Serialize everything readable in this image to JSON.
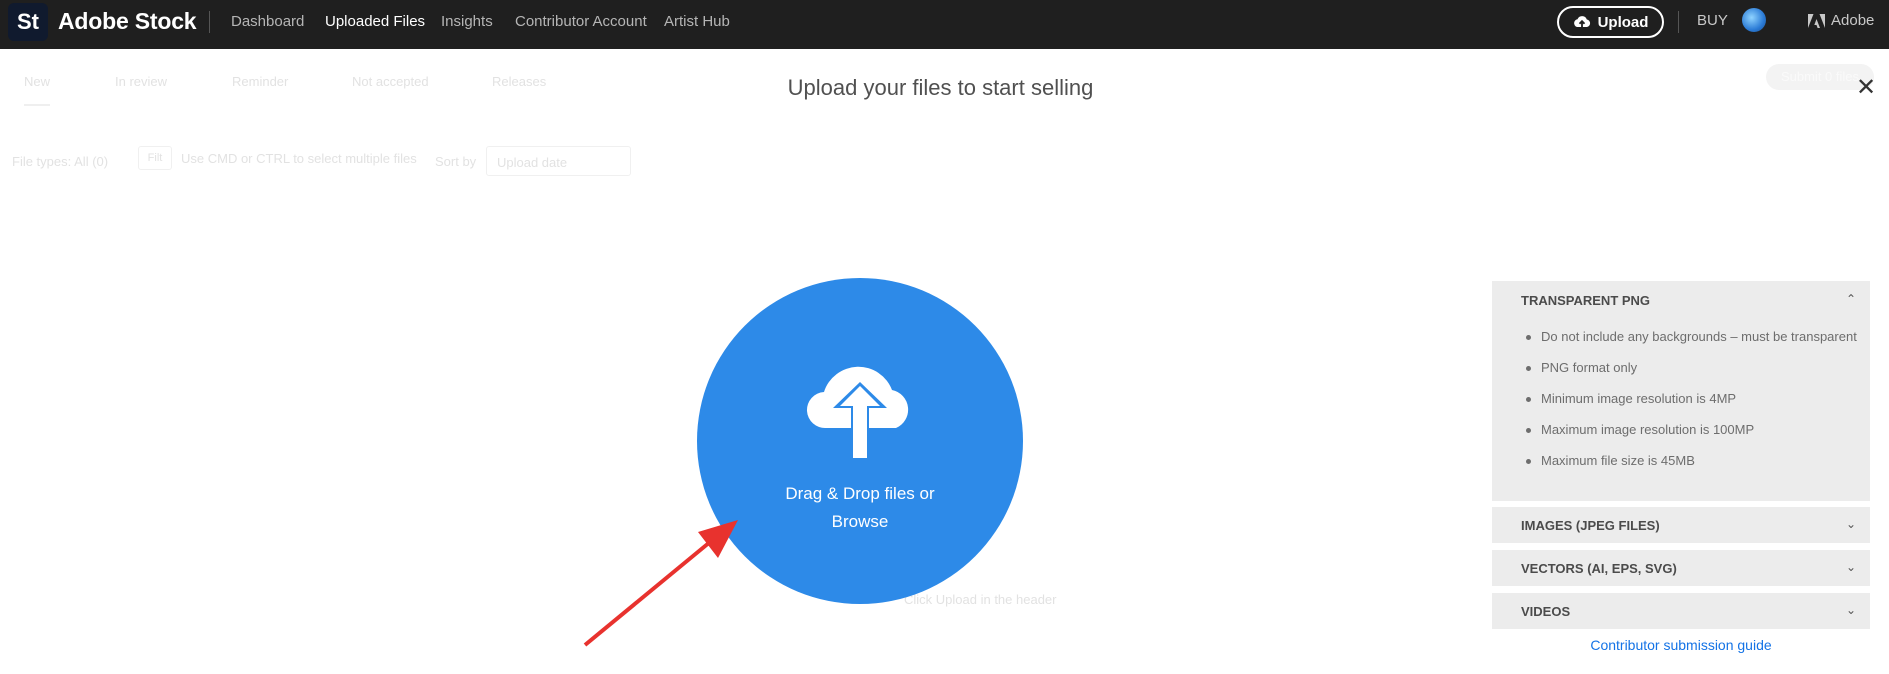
{
  "header": {
    "logo": "St",
    "brand": "Adobe Stock",
    "nav": [
      "Dashboard",
      "Uploaded Files",
      "Insights",
      "Contributor Account",
      "Artist Hub"
    ],
    "active_nav": "Uploaded Files",
    "upload_label": "Upload",
    "buy_label": "BUY",
    "adobe_label": "Adobe"
  },
  "background": {
    "tabs": [
      "New",
      "In review",
      "Reminder",
      "Not accepted",
      "Releases"
    ],
    "submit_label": "Submit 0 files",
    "file_types": "File types: All (0)",
    "filter_placeholder": "Filt",
    "hint": "Use CMD or CTRL to select multiple files",
    "sort_label": "Sort by",
    "sort_value": "Upload date",
    "empty_hint": "Click Upload in the header"
  },
  "modal": {
    "title": "Upload your files to start selling",
    "drop_line1": "Drag & Drop files or",
    "drop_line2": "Browse"
  },
  "guidelines": {
    "sections": [
      {
        "title": "TRANSPARENT PNG",
        "expanded": true,
        "items": [
          "Do not include any backgrounds – must be transparent",
          "PNG format only",
          "Minimum image resolution is 4MP",
          "Maximum image resolution is 100MP",
          "Maximum file size is 45MB"
        ]
      },
      {
        "title": "IMAGES (JPEG FILES)",
        "expanded": false
      },
      {
        "title": "VECTORS (AI, EPS, SVG)",
        "expanded": false
      },
      {
        "title": "VIDEOS",
        "expanded": false
      }
    ],
    "guide_link": "Contributor submission guide"
  },
  "colors": {
    "topbar": "#1f1f1f",
    "drop_circle": "#2d8ae8",
    "link": "#1473e6",
    "panel": "#ececec",
    "annotation_arrow": "#e8322e"
  }
}
